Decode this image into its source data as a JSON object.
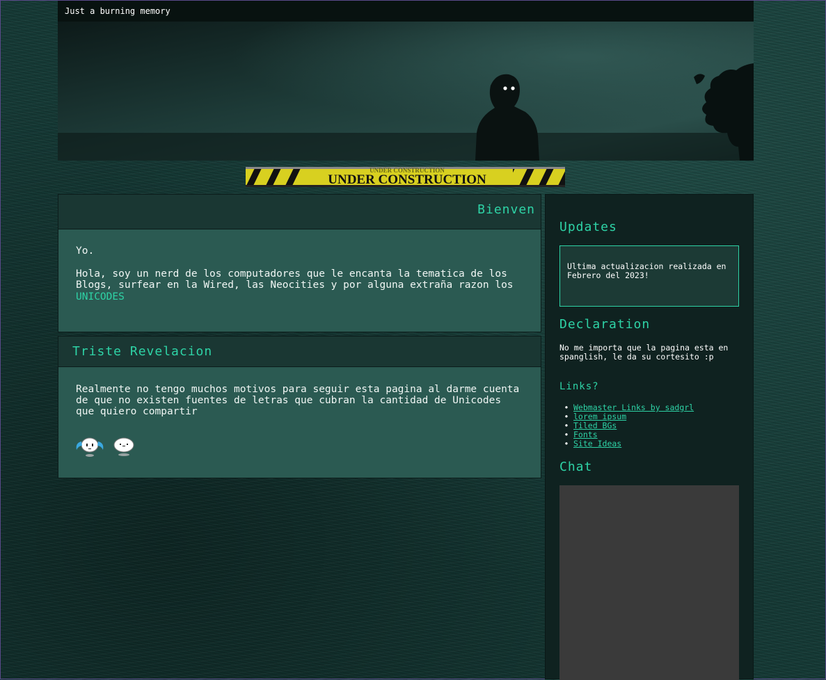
{
  "header": {
    "title": "Just a burning memory"
  },
  "banner": {
    "text_top": "UNDER CONSTRUCTION",
    "text_main": "UNDER CONSTRUCTION"
  },
  "welcome": {
    "heading": "Bienven",
    "greeting": "Yo.",
    "text": "Hola, soy un nerd de los computadores que le encanta la tematica de los Blogs, surfear en la Wired, las Neocities y por alguna extraña razon los ",
    "unicodes_link": "UNICODES"
  },
  "sad": {
    "heading": "Triste Revelacion",
    "text": "Realmente no tengo muchos motivos para seguir esta pagina al darme cuenta de que no existen fuentes de letras que cubran la cantidad de Unicodes que quiero compartir"
  },
  "sidebar": {
    "updates_heading": "Updates",
    "updates_text": "Ultima actualizacion realizada en Febrero del 2023!",
    "declaration_heading": "Declaration",
    "declaration_text": "No me importa que la pagina esta en spanglish, le da su cortesito :p",
    "links_heading": "Links?",
    "links": [
      "Webmaster Links by sadgrl",
      "lorem ipsum",
      "Tiled BGs",
      "Fonts",
      "Site Ideas"
    ],
    "chat_heading": "Chat"
  },
  "colors": {
    "accent": "#2ed3a6",
    "panel": "#2b5a52",
    "panel_head": "#1a3733",
    "sidebar": "#0f2220",
    "chat_frame": "#3a3a3a"
  }
}
